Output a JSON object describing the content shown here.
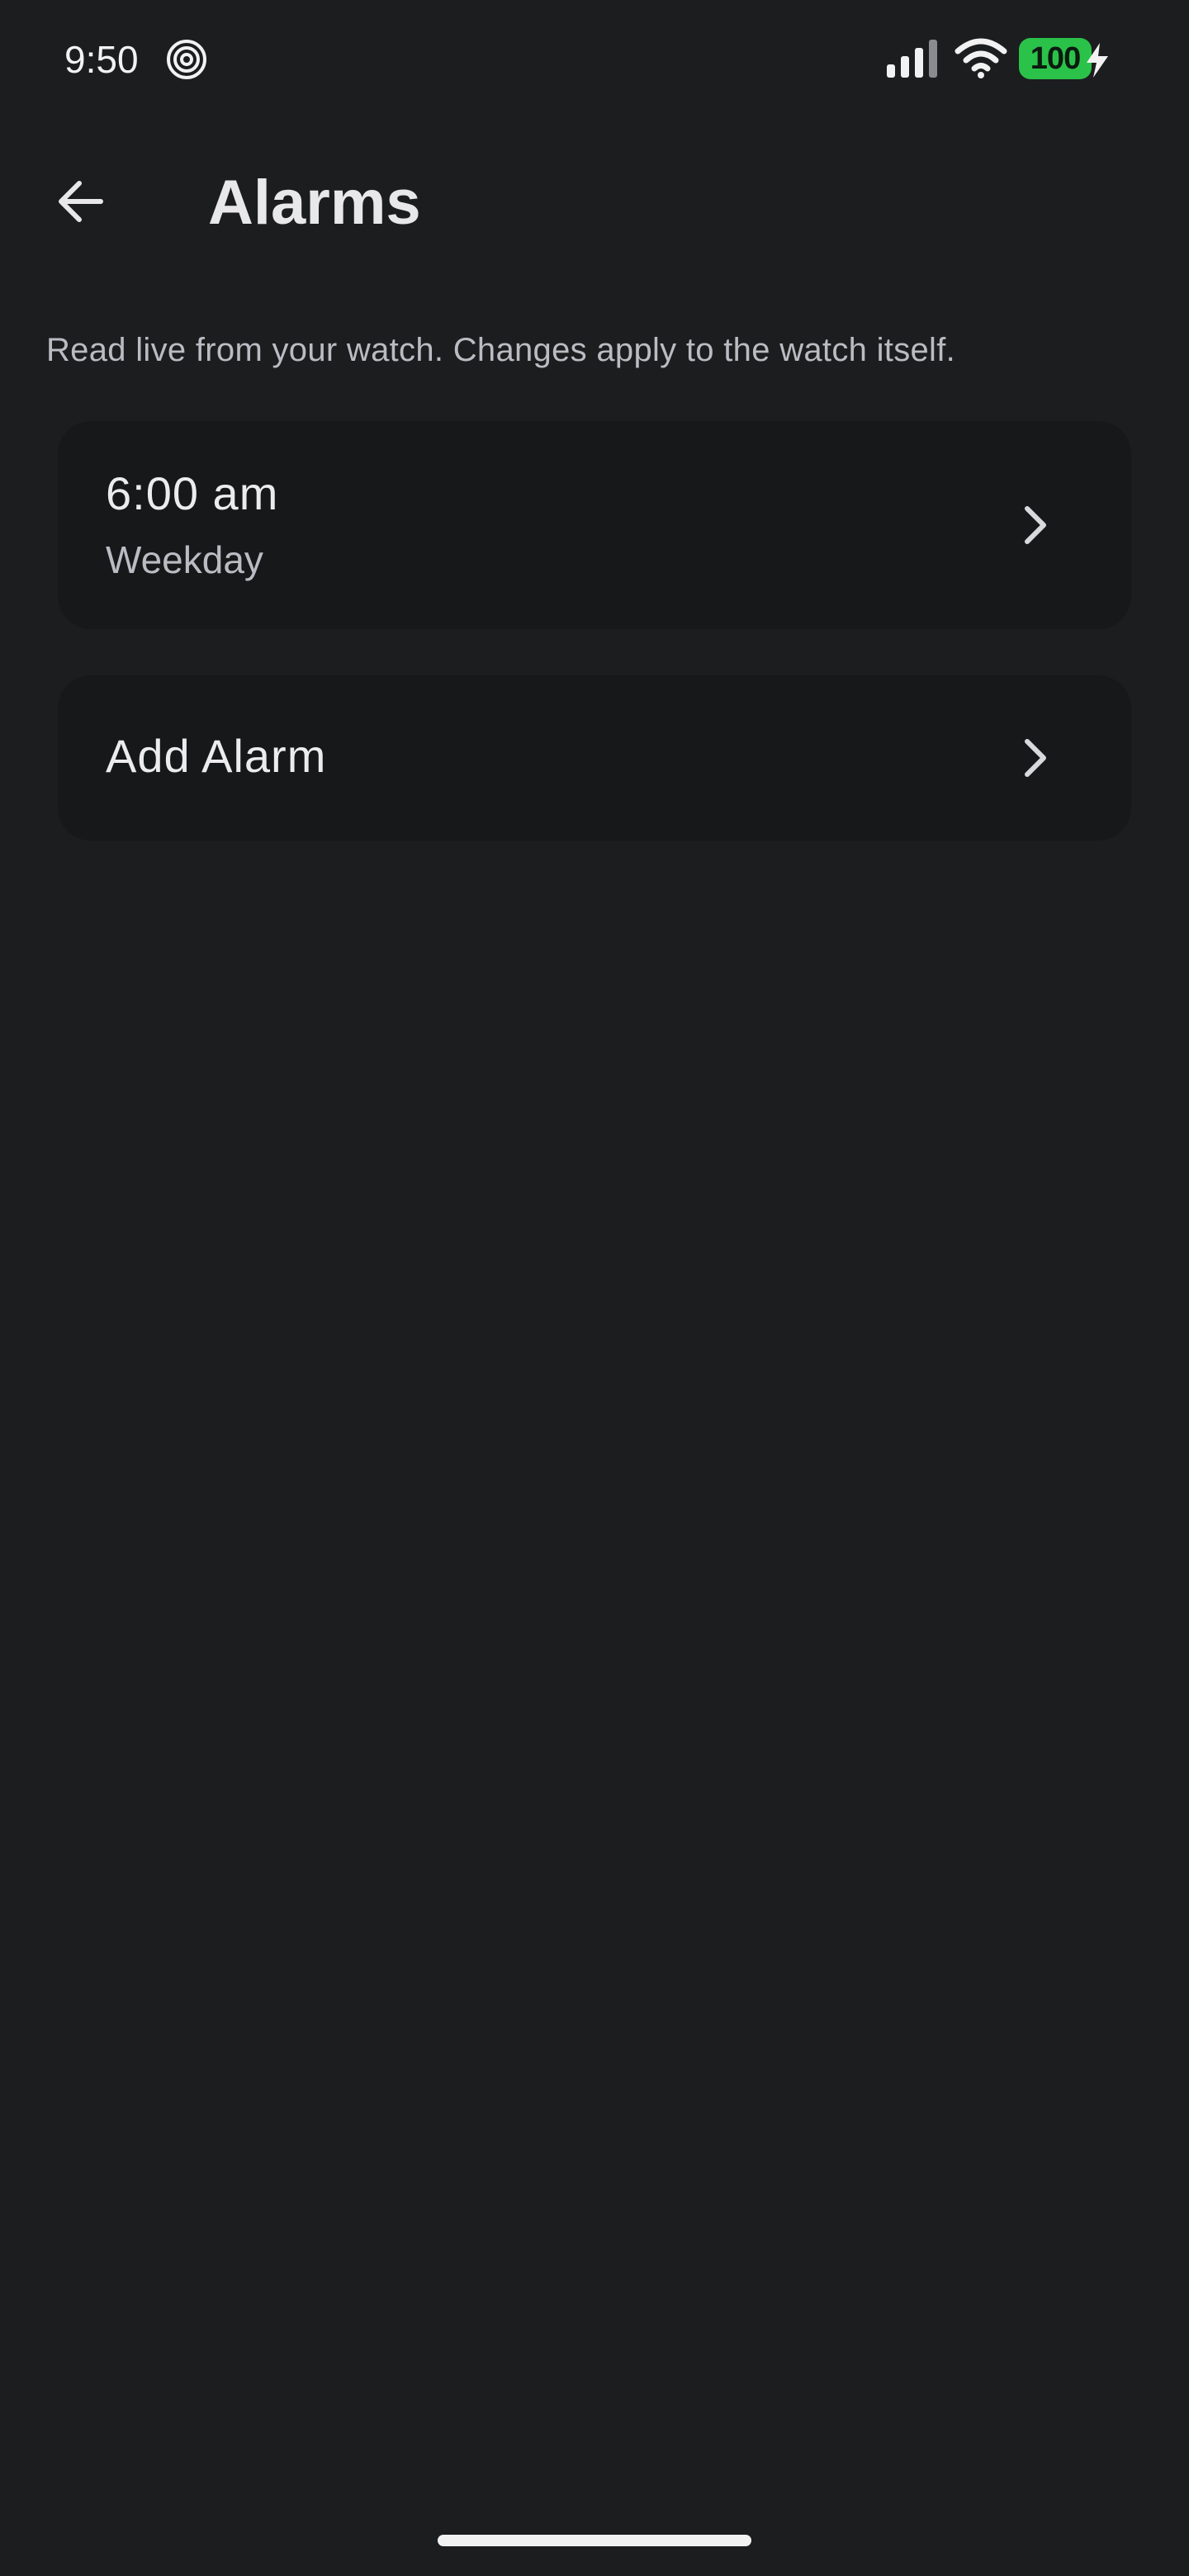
{
  "status_bar": {
    "time": "9:50",
    "battery": "100",
    "icons": [
      "app-notification-icon",
      "signal-icon",
      "wifi-icon",
      "battery-icon",
      "charging-icon"
    ],
    "battery_color": "#2bc24a"
  },
  "app_bar": {
    "back_icon": "arrow-left-icon",
    "title": "Alarms"
  },
  "description": "Read live from your watch. Changes apply to the watch itself.",
  "alarms": [
    {
      "time": "6:00 am",
      "repeat": "Weekday",
      "icon": "chevron-right-icon"
    }
  ],
  "add_alarm": {
    "label": "Add Alarm",
    "icon": "chevron-right-icon"
  },
  "colors": {
    "background": "#1c1d1f",
    "card": "#16181a",
    "primary_text": "#ececee",
    "secondary_text": "#b9bcc2"
  }
}
